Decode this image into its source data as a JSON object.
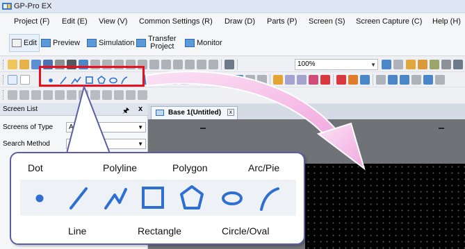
{
  "window": {
    "title": "GP-Pro EX"
  },
  "menu": [
    {
      "label": "Project (F)"
    },
    {
      "label": "Edit (E)"
    },
    {
      "label": "View (V)"
    },
    {
      "label": "Common Settings (R)"
    },
    {
      "label": "Draw (D)"
    },
    {
      "label": "Parts (P)"
    },
    {
      "label": "Screen (S)"
    },
    {
      "label": "Screen Capture (C)"
    },
    {
      "label": "Help (H)"
    }
  ],
  "modes": {
    "edit": "Edit",
    "preview": "Preview",
    "simulation": "Simulation",
    "transfer_line1": "Transfer",
    "transfer_line2": "Project",
    "monitor": "Monitor"
  },
  "toolbar": {
    "zoom": "100%"
  },
  "screen_list": {
    "title": "Screen List",
    "pin": "↑",
    "close": "x",
    "type_label": "Screens of Type",
    "type_value": "All",
    "search_label": "Search Method",
    "search_value": ""
  },
  "editor": {
    "tab_title": "Base 1(Untitled)",
    "tab_close": "x"
  },
  "callout": {
    "top_labels": [
      "Dot",
      "Polyline",
      "Polygon",
      "Arc/Pie"
    ],
    "bottom_labels": [
      "Line",
      "Rectangle",
      "Circle/Oval"
    ]
  },
  "colors": {
    "highlight_border": "#e8101c",
    "callout_border": "#5b5ea6",
    "shape_blue": "#2e6fd4",
    "arrow_pink": "#f7c0ea"
  },
  "icons": [
    "app-logo-icon",
    "dot-tool-icon",
    "line-tool-icon",
    "polyline-tool-icon",
    "rectangle-tool-icon",
    "polygon-tool-icon",
    "circle-tool-icon",
    "arc-tool-icon",
    "pin-icon",
    "close-icon"
  ]
}
